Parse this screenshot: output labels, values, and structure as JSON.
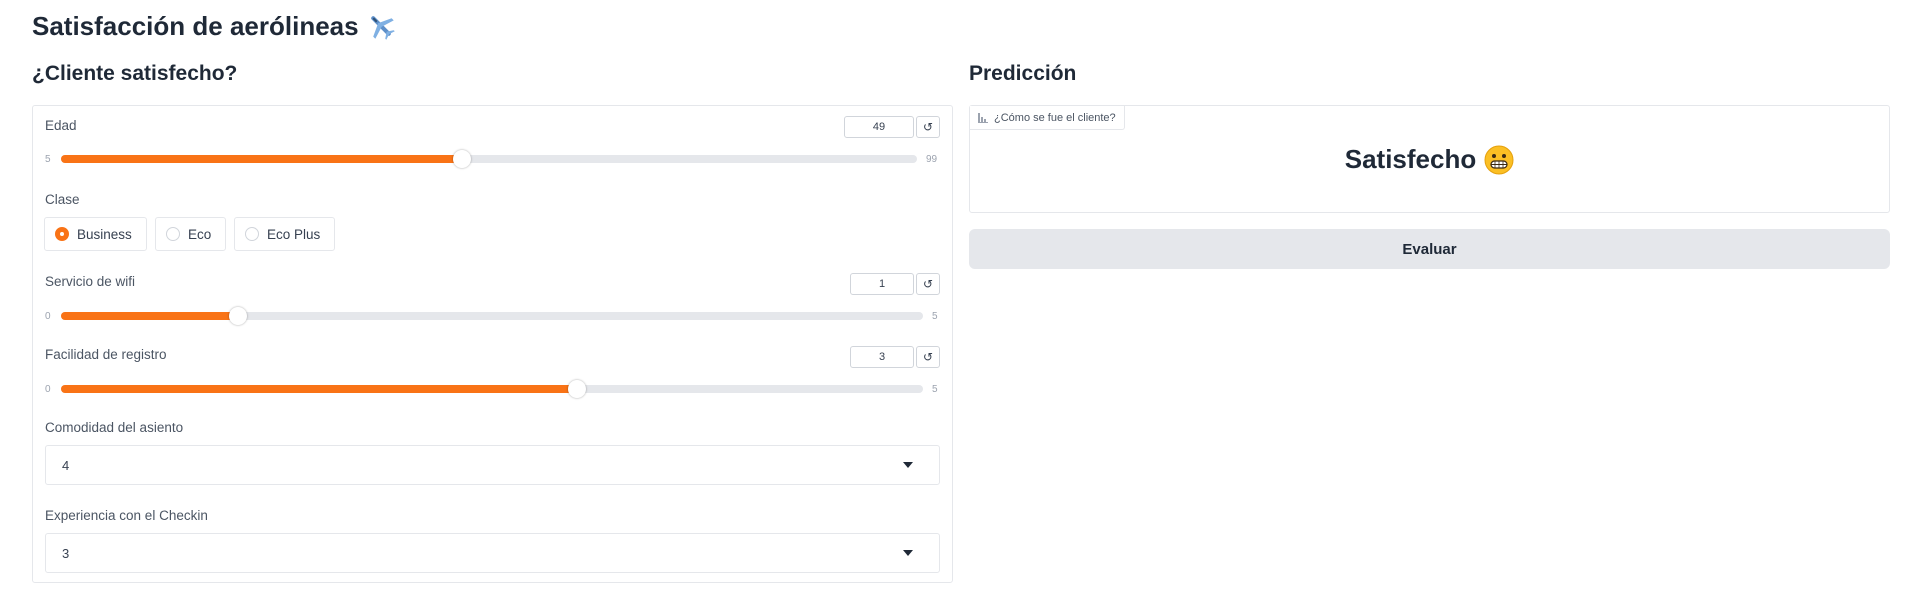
{
  "app": {
    "title": "Satisfacción de aerólineas"
  },
  "left": {
    "title": "¿Cliente satisfecho?",
    "edad": {
      "label": "Edad",
      "value": "49",
      "min": "5",
      "max": "99",
      "reset": "↺"
    },
    "clase": {
      "label": "Clase",
      "options": [
        "Business",
        "Eco",
        "Eco Plus"
      ],
      "selected": "Business"
    },
    "wifi": {
      "label": "Servicio de wifi",
      "value": "1",
      "min": "0",
      "max": "5",
      "reset": "↺"
    },
    "registro": {
      "label": "Facilidad de registro",
      "value": "3",
      "min": "0",
      "max": "5",
      "reset": "↺"
    },
    "asiento": {
      "label": "Comodidad del asiento",
      "value": "4"
    },
    "checkin": {
      "label": "Experiencia con el Checkin",
      "value": "3"
    }
  },
  "right": {
    "title": "Predicción",
    "output_label": "¿Cómo se fue el cliente?",
    "result": "Satisfecho",
    "evaluate_label": "Evaluar"
  },
  "colors": {
    "accent": "#f97316",
    "track": "#e5e7eb",
    "button": "#e5e7eb"
  },
  "icons": {
    "title_icon": "airplane-icon",
    "result_icon": "grinning-face-icon",
    "output_icon": "label-icon"
  }
}
